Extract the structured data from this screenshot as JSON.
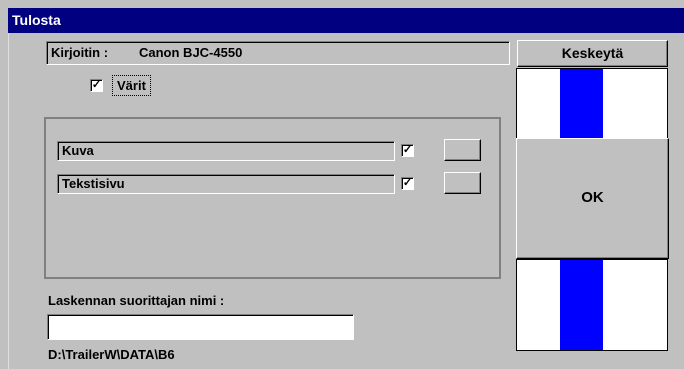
{
  "window": {
    "title": "Tulosta"
  },
  "printer": {
    "label": "Kirjoitin :",
    "name": "Canon BJC-4550"
  },
  "colors_option": {
    "label": "Värit",
    "checked": "✓"
  },
  "documents": [
    {
      "name": "Kuva",
      "checked": "✓"
    },
    {
      "name": "Tekstisivu",
      "checked": "✓"
    }
  ],
  "calculator": {
    "label": "Laskennan suorittajan nimi :",
    "value": ""
  },
  "path": "D:\\TrailerW\\DATA\\B6",
  "buttons": {
    "cancel": "Keskeytä",
    "ok": "OK"
  },
  "accent_color": "#0000ff"
}
